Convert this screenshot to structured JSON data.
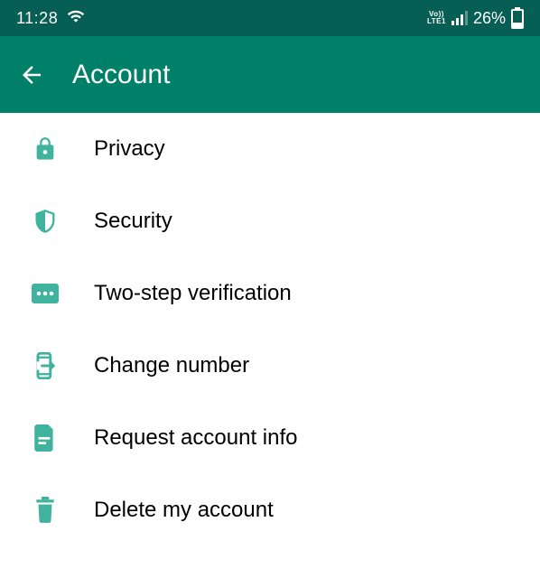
{
  "status_bar": {
    "time": "11:28",
    "network_label_top": "Vo))",
    "network_label_bottom": "LTE1",
    "battery_percent": "26%"
  },
  "app_bar": {
    "title": "Account"
  },
  "menu": {
    "items": [
      {
        "label": "Privacy"
      },
      {
        "label": "Security"
      },
      {
        "label": "Two-step verification"
      },
      {
        "label": "Change number"
      },
      {
        "label": "Request account info"
      },
      {
        "label": "Delete my account"
      }
    ]
  },
  "colors": {
    "status_bg": "#075e54",
    "appbar_bg": "#008069",
    "icon": "#3fb39d"
  }
}
